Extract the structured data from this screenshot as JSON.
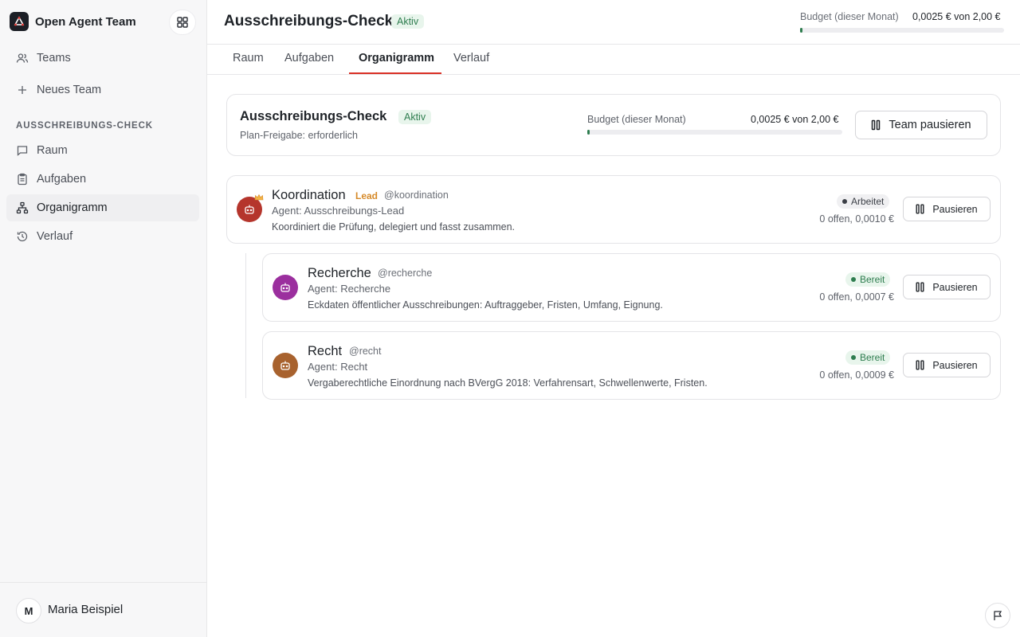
{
  "app": {
    "name": "Open Agent Team"
  },
  "sidebar": {
    "items": [
      {
        "label": "Teams",
        "icon": "users-icon"
      },
      {
        "label": "Neues Team",
        "icon": "plus-icon"
      }
    ],
    "section_label": "AUSSCHREIBUNGS-CHECK",
    "team_items": [
      {
        "label": "Raum",
        "icon": "chat-icon"
      },
      {
        "label": "Aufgaben",
        "icon": "clipboard-icon"
      },
      {
        "label": "Organigramm",
        "icon": "org-chart-icon",
        "active": true
      },
      {
        "label": "Verlauf",
        "icon": "history-icon"
      }
    ],
    "user": {
      "initial": "M",
      "name": "Maria Beispiel"
    }
  },
  "header": {
    "title": "Ausschreibungs-Check",
    "status": "Aktiv",
    "budget_label": "Budget (dieser Monat)",
    "budget_value": "0,0025 € von 2,00 €",
    "budget_used_fraction": 0.00125
  },
  "tabs": [
    {
      "label": "Raum"
    },
    {
      "label": "Aufgaben"
    },
    {
      "label": "Organigramm",
      "active": true
    },
    {
      "label": "Verlauf"
    }
  ],
  "team": {
    "title": "Ausschreibungs-Check",
    "status": "Aktiv",
    "plan_approval": "Plan-Freigabe: erforderlich",
    "budget_label": "Budget (dieser Monat)",
    "budget_value": "0,0025 € von 2,00 €",
    "budget_used_fraction": 0.00125,
    "pause_label": "Team pausieren"
  },
  "agents": [
    {
      "name": "Koordination",
      "lead_label": "Lead",
      "handle": "@koordination",
      "role": "Agent: Ausschreibungs-Lead",
      "description": "Koordiniert die Prüfung, delegiert und fasst zusammen.",
      "status": "Arbeitet",
      "stats": "0 offen, 0,0010 €",
      "pause_label": "Pausieren",
      "color": "#b5352c"
    },
    {
      "name": "Recherche",
      "handle": "@recherche",
      "role": "Agent: Recherche",
      "description": "Eckdaten öffentlicher Ausschreibungen: Auftraggeber, Fristen, Umfang, Eignung.",
      "status": "Bereit",
      "stats": "0 offen, 0,0007 €",
      "pause_label": "Pausieren",
      "color": "#9b2f9e"
    },
    {
      "name": "Recht",
      "handle": "@recht",
      "role": "Agent: Recht",
      "description": "Vergaberechtliche Einordnung nach BVergG 2018: Verfahrensart, Schwellenwerte, Fristen.",
      "status": "Bereit",
      "stats": "0 offen, 0,0009 €",
      "pause_label": "Pausieren",
      "color": "#a8622e"
    }
  ],
  "colors": {
    "accent": "#d93025",
    "success": "#2e7d4f",
    "lead": "#d68a2a"
  }
}
